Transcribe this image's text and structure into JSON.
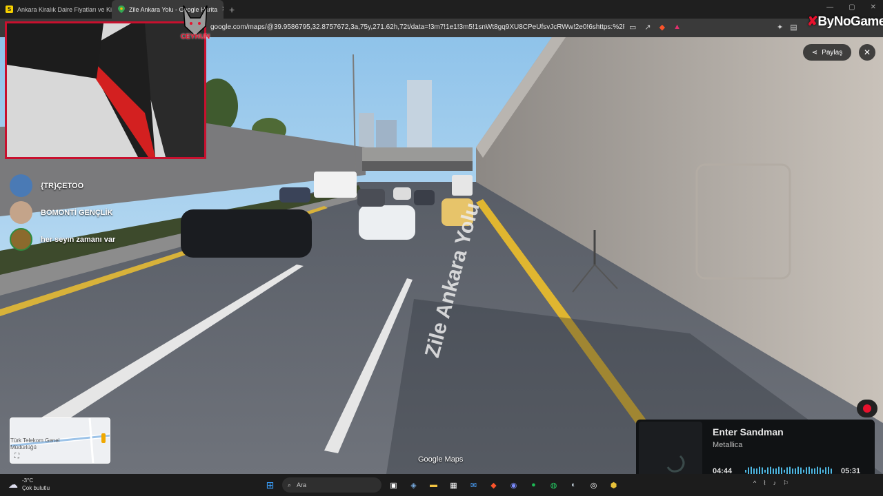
{
  "browser": {
    "tabs": [
      {
        "title": "Ankara Kiralık Daire Fiyatları ve Kiral...",
        "favicon": "S",
        "active": false
      },
      {
        "title": "Zile Ankara Yolu - Google Harita",
        "favicon": "maps-pin",
        "active": true
      }
    ],
    "url": "google.com/maps/@39.9586795,32.8757672,3a,75y,271.62h,72t/data=!3m7!1e1!3m5!1snWt8gq9XU8CPeUfsvJcRWw!2e0!6shttps:%2F%2Fstreet..."
  },
  "overlay": {
    "webcam_logo_text": "CEYHUN",
    "brand": {
      "prefix": "By",
      "name": "NoGame"
    }
  },
  "streetview": {
    "share_label": "Paylaş",
    "street_name": "Zile Ankara Yolu",
    "watermark": "Google Maps",
    "minimap_label": "Türk Telekom Genel Müdürlüğü"
  },
  "chat": [
    {
      "user": "{TR}ÇETOO",
      "avatar_color": "#4a7ab5"
    },
    {
      "user": "BOMONTİ GENÇLİK",
      "avatar_color": "#c4a48a"
    },
    {
      "user": "her seyın zamanı var",
      "avatar_color": "#8b6a2d"
    }
  ],
  "music": {
    "title": "Enter Sandman",
    "artist": "Metallica",
    "current_time": "04:44",
    "total_time": "05:31",
    "progress": 0.86
  },
  "taskbar": {
    "weather_temp": "-3°C",
    "weather_desc": "Çok bulutlu",
    "search_placeholder": "Ara"
  },
  "colors": {
    "accent": "#c8102e",
    "progress": "#4fb8e3"
  }
}
